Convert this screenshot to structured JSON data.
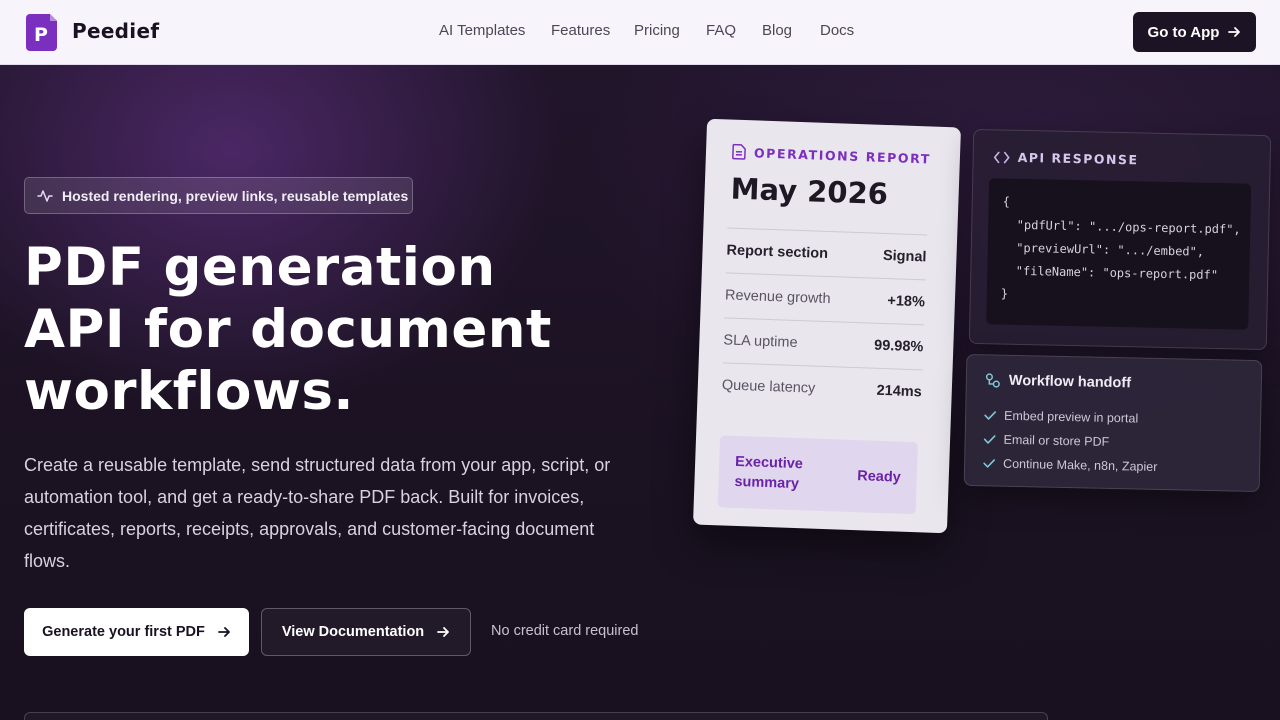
{
  "brand": {
    "name": "Peedief",
    "logo_letter": "P",
    "accent": "#7b2fbe"
  },
  "nav": {
    "links": [
      "AI Templates",
      "Features",
      "Pricing",
      "FAQ",
      "Blog",
      "Docs"
    ],
    "cta": "Go to App"
  },
  "hero": {
    "badge": "Hosted rendering, preview links, reusable templates",
    "headline": [
      "PDF generation",
      "API for document",
      "workflows."
    ],
    "lede": "Create a reusable template, send structured data from your app, script, or automation tool, and get a ready-to-share PDF back. Built for invoices, certificates, reports, receipts, approvals, and customer-facing document flows.",
    "primary_cta": "Generate your first PDF",
    "secondary_cta": "View Documentation",
    "note": "No credit card required"
  },
  "report_card": {
    "kicker": "OPERATIONS REPORT",
    "title": "May 2026",
    "header": {
      "k": "Report section",
      "v": "Signal"
    },
    "rows": [
      {
        "k": "Revenue growth",
        "v": "+18%"
      },
      {
        "k": "SLA uptime",
        "v": "99.98%"
      },
      {
        "k": "Queue latency",
        "v": "214ms"
      }
    ],
    "summary_label": "Executive summary",
    "summary_status": "Ready"
  },
  "api_card": {
    "title": "API RESPONSE",
    "code": "{\n  \"pdfUrl\": \".../ops-report.pdf\",\n  \"previewUrl\": \".../embed\",\n  \"fileName\": \"ops-report.pdf\"\n}"
  },
  "workflow_card": {
    "title": "Workflow handoff",
    "items": [
      "Embed preview in portal",
      "Email or store PDF",
      "Continue Make, n8n, Zapier"
    ]
  }
}
